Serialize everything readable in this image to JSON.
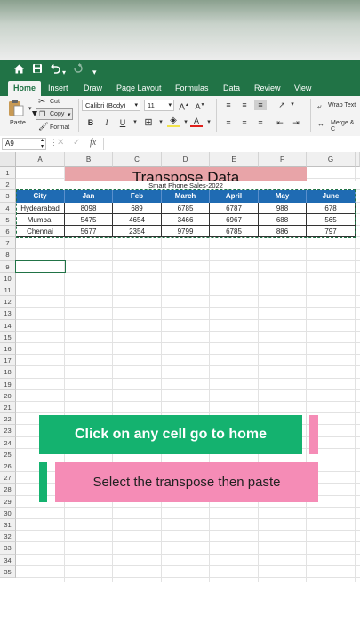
{
  "quick_access": {
    "icons": [
      "home-icon",
      "save-icon",
      "undo-icon",
      "redo-icon",
      "customize-icon"
    ]
  },
  "tabs": [
    "Home",
    "Insert",
    "Draw",
    "Page Layout",
    "Formulas",
    "Data",
    "Review",
    "View"
  ],
  "active_tab": "Home",
  "ribbon": {
    "paste": "Paste",
    "cut": "Cut",
    "copy": "Copy",
    "format": "Format",
    "font": "Calibri (Body)",
    "size": "11",
    "wrap": "Wrap Text",
    "merge": "Merge & C"
  },
  "formula_bar": {
    "name_box": "A9",
    "fx": "fx",
    "value": ""
  },
  "columns": [
    "A",
    "B",
    "C",
    "D",
    "E",
    "F",
    "G"
  ],
  "rows": [
    "1",
    "2",
    "3",
    "4",
    "5",
    "6",
    "7",
    "8",
    "9",
    "10",
    "11",
    "12",
    "13",
    "14",
    "15",
    "16",
    "17",
    "18",
    "19",
    "20",
    "21",
    "22",
    "23",
    "24",
    "25",
    "26",
    "27",
    "28",
    "29",
    "30",
    "31",
    "32",
    "33",
    "34",
    "35"
  ],
  "sheet": {
    "title": "Transpose Data",
    "subtitle": "Smart Phone Sales-2022",
    "headers": [
      "City",
      "Jan",
      "Feb",
      "March",
      "April",
      "May",
      "June"
    ],
    "data": [
      [
        "Hydearabad",
        "8098",
        "689",
        "6785",
        "6787",
        "988",
        "678"
      ],
      [
        "Mumbai",
        "5475",
        "4654",
        "3466",
        "6967",
        "688",
        "565"
      ],
      [
        "Chennai",
        "5677",
        "2354",
        "9799",
        "6785",
        "886",
        "797"
      ]
    ]
  },
  "captions": {
    "line1": "Click on any cell go to home",
    "line2": "Select the transpose then paste"
  },
  "colors": {
    "excel_green": "#217346",
    "header_blue": "#1f6bb3",
    "title_pink": "#e8a4a8",
    "caption_green": "#14b26f",
    "caption_pink": "#f58cb6"
  }
}
